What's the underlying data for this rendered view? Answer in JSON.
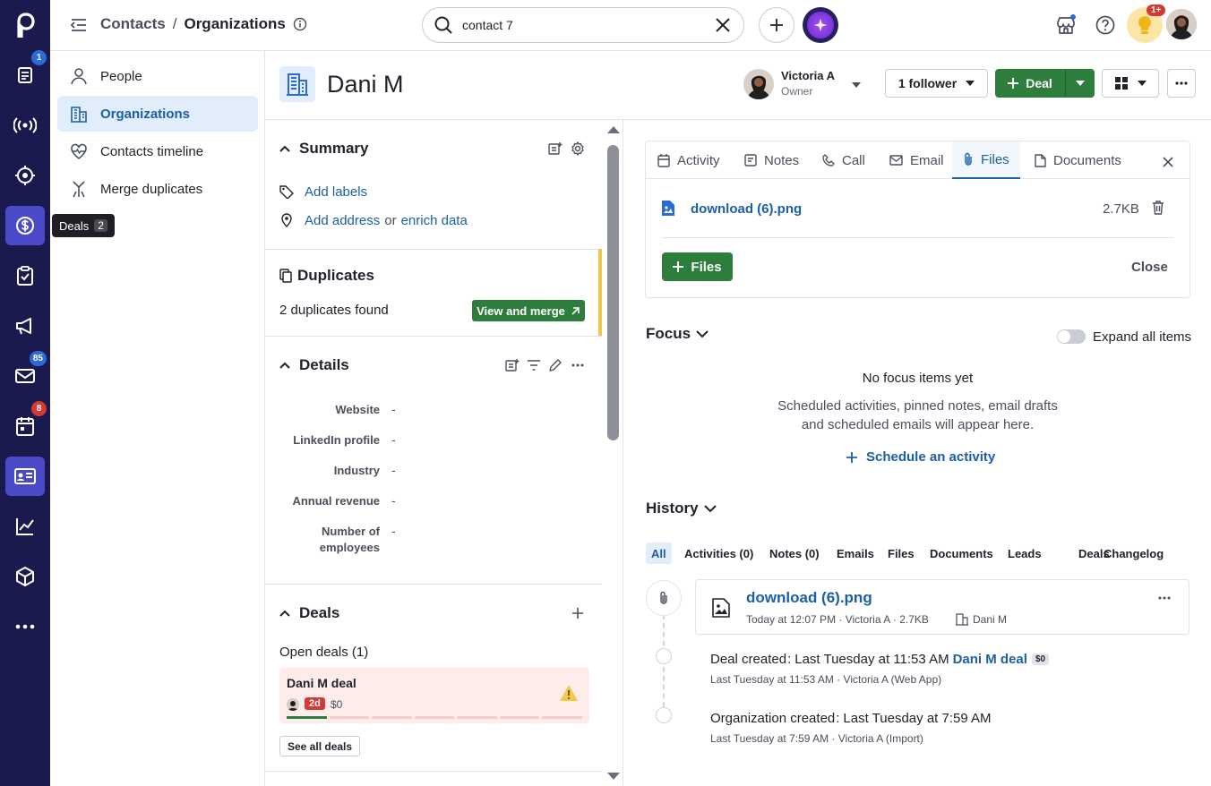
{
  "rail": {
    "badges": {
      "activity": "1",
      "mail": "85",
      "calendar": "8"
    },
    "tooltip": {
      "label": "Deals",
      "shortcut": "2"
    }
  },
  "topbar": {
    "breadcrumb_parent": "Contacts",
    "breadcrumb_sep": "/",
    "breadcrumb_current": "Organizations",
    "search_value": "contact 7",
    "notification_badge": "1+"
  },
  "subnav": {
    "items": [
      {
        "label": "People"
      },
      {
        "label": "Organizations"
      },
      {
        "label": "Contacts timeline"
      },
      {
        "label": "Merge duplicates"
      }
    ]
  },
  "header": {
    "org_name": "Dani M",
    "owner_name": "Victoria A",
    "owner_role": "Owner",
    "follower_label": "1 follower",
    "deal_button": "Deal"
  },
  "summary": {
    "title": "Summary",
    "add_labels": "Add labels",
    "add_address": "Add address",
    "or": "or",
    "enrich": "enrich data"
  },
  "duplicates": {
    "title": "Duplicates",
    "found_text": "2 duplicates found",
    "merge_button": "View and merge"
  },
  "details": {
    "title": "Details",
    "fields": [
      {
        "label": "Website",
        "value": "-"
      },
      {
        "label": "LinkedIn profile",
        "value": "-"
      },
      {
        "label": "Industry",
        "value": "-"
      },
      {
        "label": "Annual revenue",
        "value": "-"
      },
      {
        "label": "Number of",
        "label2": "employees",
        "value": "-"
      }
    ]
  },
  "deals": {
    "title": "Deals",
    "open_label": "Open deals (1)",
    "card": {
      "name": "Dani M deal",
      "age": "2d",
      "value": "$0"
    },
    "see_all": "See all deals"
  },
  "composer": {
    "tabs": [
      {
        "label": "Activity"
      },
      {
        "label": "Notes"
      },
      {
        "label": "Call"
      },
      {
        "label": "Email"
      },
      {
        "label": "Files"
      },
      {
        "label": "Documents"
      }
    ],
    "file_name": "download (6).png",
    "file_size": "2.7KB",
    "files_button": "Files",
    "close_label": "Close"
  },
  "focus": {
    "title": "Focus",
    "expand_label": "Expand all items",
    "empty_title": "No focus items yet",
    "empty_line1": "Scheduled activities, pinned notes, email drafts",
    "empty_line2": "and scheduled emails will appear here.",
    "schedule_link": "Schedule an activity"
  },
  "history": {
    "title": "History",
    "tabs": [
      {
        "label": "All"
      },
      {
        "label": "Activities (0)"
      },
      {
        "label": "Notes (0)"
      },
      {
        "label": "Emails"
      },
      {
        "label": "Files"
      },
      {
        "label": "Documents"
      },
      {
        "label": "Leads"
      },
      {
        "label": "Deals"
      },
      {
        "label": "Changelog"
      }
    ],
    "file_item": {
      "name": "download (6).png",
      "meta": "Today at 12:07 PM · Victoria A · 2.7KB",
      "org": "Dani M"
    },
    "events": [
      {
        "label": "Deal created",
        "when": "Last Tuesday at 11:53 AM",
        "link": "Dani M deal",
        "badge": "$0",
        "meta": "Last Tuesday at 11:53 AM · Victoria A (Web App)"
      },
      {
        "label": "Organization created",
        "when": "Last Tuesday at 7:59 AM",
        "meta": "Last Tuesday at 7:59 AM · Victoria A (Import)"
      }
    ]
  }
}
